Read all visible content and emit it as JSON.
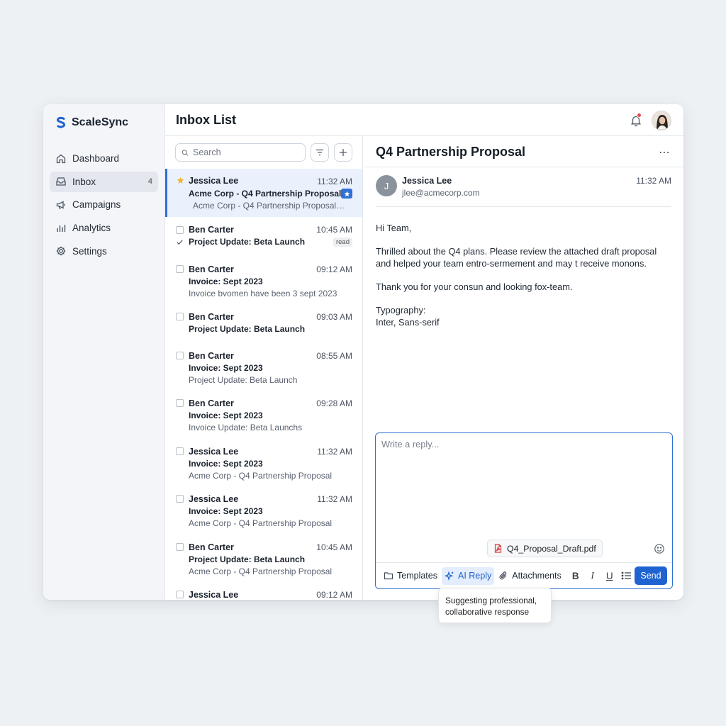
{
  "app": {
    "name": "ScaleSync"
  },
  "header": {
    "title": "Inbox List"
  },
  "sidebar": {
    "items": [
      {
        "label": "Dashboard",
        "icon": "home-icon"
      },
      {
        "label": "Inbox",
        "icon": "inbox-icon",
        "count": "4",
        "active": true
      },
      {
        "label": "Campaigns",
        "icon": "megaphone-icon"
      },
      {
        "label": "Analytics",
        "icon": "bar-chart-icon"
      },
      {
        "label": "Settings",
        "icon": "gear-icon"
      }
    ]
  },
  "list": {
    "search_placeholder": "Search",
    "messages": [
      {
        "sender": "Jessica Lee",
        "time": "11:32 AM",
        "subject": "Acme Corp - Q4 Partnership Proposal",
        "preview": "Acme Corp - Q4 Partnership Proposal ...",
        "starred": true,
        "selected": true
      },
      {
        "sender": "Ben Carter",
        "time": "10:45 AM",
        "subject": "Project Update: Beta Launch",
        "badge": "read",
        "checked": true
      },
      {
        "sender": "Ben Carter",
        "time": "09:12 AM",
        "subject": "Invoice: Sept 2023",
        "preview": "Invoice bvomen have been 3 sept 2023"
      },
      {
        "sender": "Ben Carter",
        "time": "09:03 AM",
        "subject": "Project Update: Beta Launch"
      },
      {
        "sender": "Ben Carter",
        "time": "08:55 AM",
        "subject": "Invoice: Sept 2023",
        "preview": "Project Update: Beta Launch"
      },
      {
        "sender": "Ben Carter",
        "time": "09:28 AM",
        "subject": "Invoice: Sept 2023",
        "preview": "Invoice Update: Beta Launchs"
      },
      {
        "sender": "Jessica Lee",
        "time": "11:32 AM",
        "subject": "Invoice: Sept 2023",
        "preview": "Acme Corp - Q4 Partnership Proposal"
      },
      {
        "sender": "Jessica Lee",
        "time": "11:32 AM",
        "subject": "Invoice: Sept 2023",
        "preview": "Acme Corp - Q4 Partnership Proposal"
      },
      {
        "sender": "Ben Carter",
        "time": "10:45 AM",
        "subject": "Project Update: Beta Launch",
        "preview": "Acme Corp - Q4 Partnership Proposal"
      },
      {
        "sender": "Jessica Lee",
        "time": "09:12 AM"
      }
    ]
  },
  "reader": {
    "title": "Q4 Partnership Proposal",
    "from_initial": "J",
    "from_name": "Jessica Lee",
    "from_email": "jlee@acmecorp.com",
    "time": "11:32 AM",
    "body": [
      "Hi Team,",
      "Thrilled about the Q4 plans. Please review the attached draft proposal and helped your team entro-sermement and may t receive monons.",
      "Thank you for your consun and looking fox-team.",
      "Typography:\nInter, Sans-serif"
    ]
  },
  "reply": {
    "placeholder": "Write a reply...",
    "attachment": "Q4_Proposal_Draft.pdf",
    "templates_label": "Templates",
    "ai_label": "AI Reply",
    "attachments_label": "Attachments",
    "bold": "B",
    "italic": "I",
    "underline": "U",
    "send_label": "Send",
    "tooltip": "Suggesting professional, collaborative response"
  },
  "colors": {
    "accent": "#1f63d1",
    "star": "#f0b429",
    "notification": "#e5484d"
  }
}
